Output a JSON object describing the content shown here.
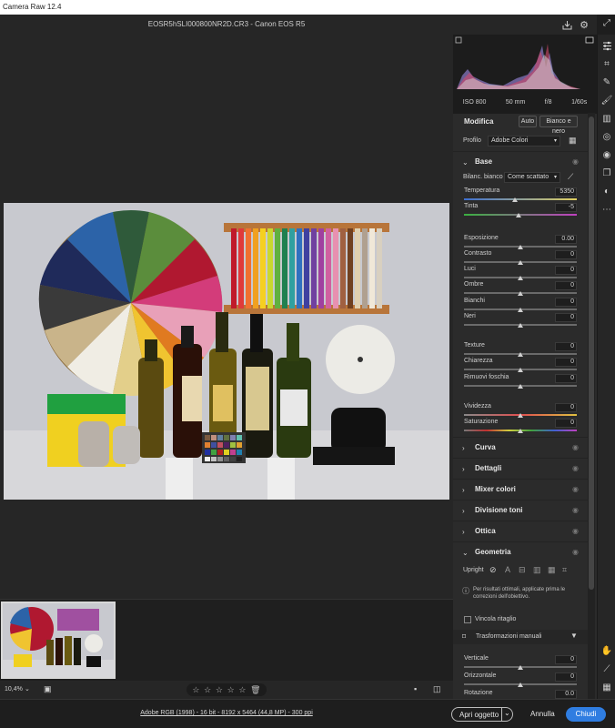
{
  "window": {
    "title": "Camera Raw 12.4"
  },
  "document": {
    "filename": "EOSR5hSLI000800NR2D.CR3  -  Canon EOS R5"
  },
  "camera_info": {
    "iso": "ISO 800",
    "focal": "50 mm",
    "aperture": "f/8",
    "shutter": "1/60s"
  },
  "edit": {
    "title": "Modifica",
    "auto_label": "Auto",
    "bw_label": "Bianco e nero",
    "profile_label": "Profilo",
    "profile_value": "Adobe Colori"
  },
  "base": {
    "title": "Base",
    "wb_label": "Bilanc. bianco",
    "wb_value": "Come scattato",
    "sliders": [
      {
        "label": "Temperatura",
        "value": "5350",
        "pos": 0.45
      },
      {
        "label": "Tinta",
        "value": "-5",
        "pos": 0.48
      },
      {
        "label": "Esposizione",
        "value": "0.00",
        "pos": 0.5
      },
      {
        "label": "Contrasto",
        "value": "0",
        "pos": 0.5
      },
      {
        "label": "Luci",
        "value": "0",
        "pos": 0.5
      },
      {
        "label": "Ombre",
        "value": "0",
        "pos": 0.5
      },
      {
        "label": "Bianchi",
        "value": "0",
        "pos": 0.5
      },
      {
        "label": "Neri",
        "value": "0",
        "pos": 0.5
      },
      {
        "label": "Texture",
        "value": "0",
        "pos": 0.5
      },
      {
        "label": "Chiarezza",
        "value": "0",
        "pos": 0.5
      },
      {
        "label": "Rimuovi foschia",
        "value": "0",
        "pos": 0.5
      },
      {
        "label": "Vividezza",
        "value": "0",
        "pos": 0.5
      },
      {
        "label": "Saturazione",
        "value": "0",
        "pos": 0.5
      }
    ]
  },
  "sections": [
    {
      "title": "Curva"
    },
    {
      "title": "Dettagli"
    },
    {
      "title": "Mixer colori"
    },
    {
      "title": "Divisione toni"
    },
    {
      "title": "Ottica"
    },
    {
      "title": "Geometria"
    }
  ],
  "geometry": {
    "upright_label": "Upright",
    "info_text": "Per risultati ottimali, applicate prima le correzioni dell'obiettivo.",
    "crop_label": "Vincola ritaglio",
    "manual_label": "Trasformazioni manuali",
    "sliders": [
      {
        "label": "Verticale",
        "value": "0",
        "pos": 0.5
      },
      {
        "label": "Orizzontale",
        "value": "0",
        "pos": 0.5
      },
      {
        "label": "Rotazione",
        "value": "0.0",
        "pos": 0.5
      }
    ]
  },
  "footer": {
    "zoom": "10,4%",
    "file_info": "Adobe RGB (1998) - 16 bit - 8192 x 5464 (44,8 MP) - 300 ppi",
    "open_label": "Apri oggetto",
    "cancel_label": "Annulla",
    "done_label": "Chiudi"
  },
  "colors": {
    "accent_blue": "#2f7de1",
    "panel_bg": "#2b2b2b"
  }
}
